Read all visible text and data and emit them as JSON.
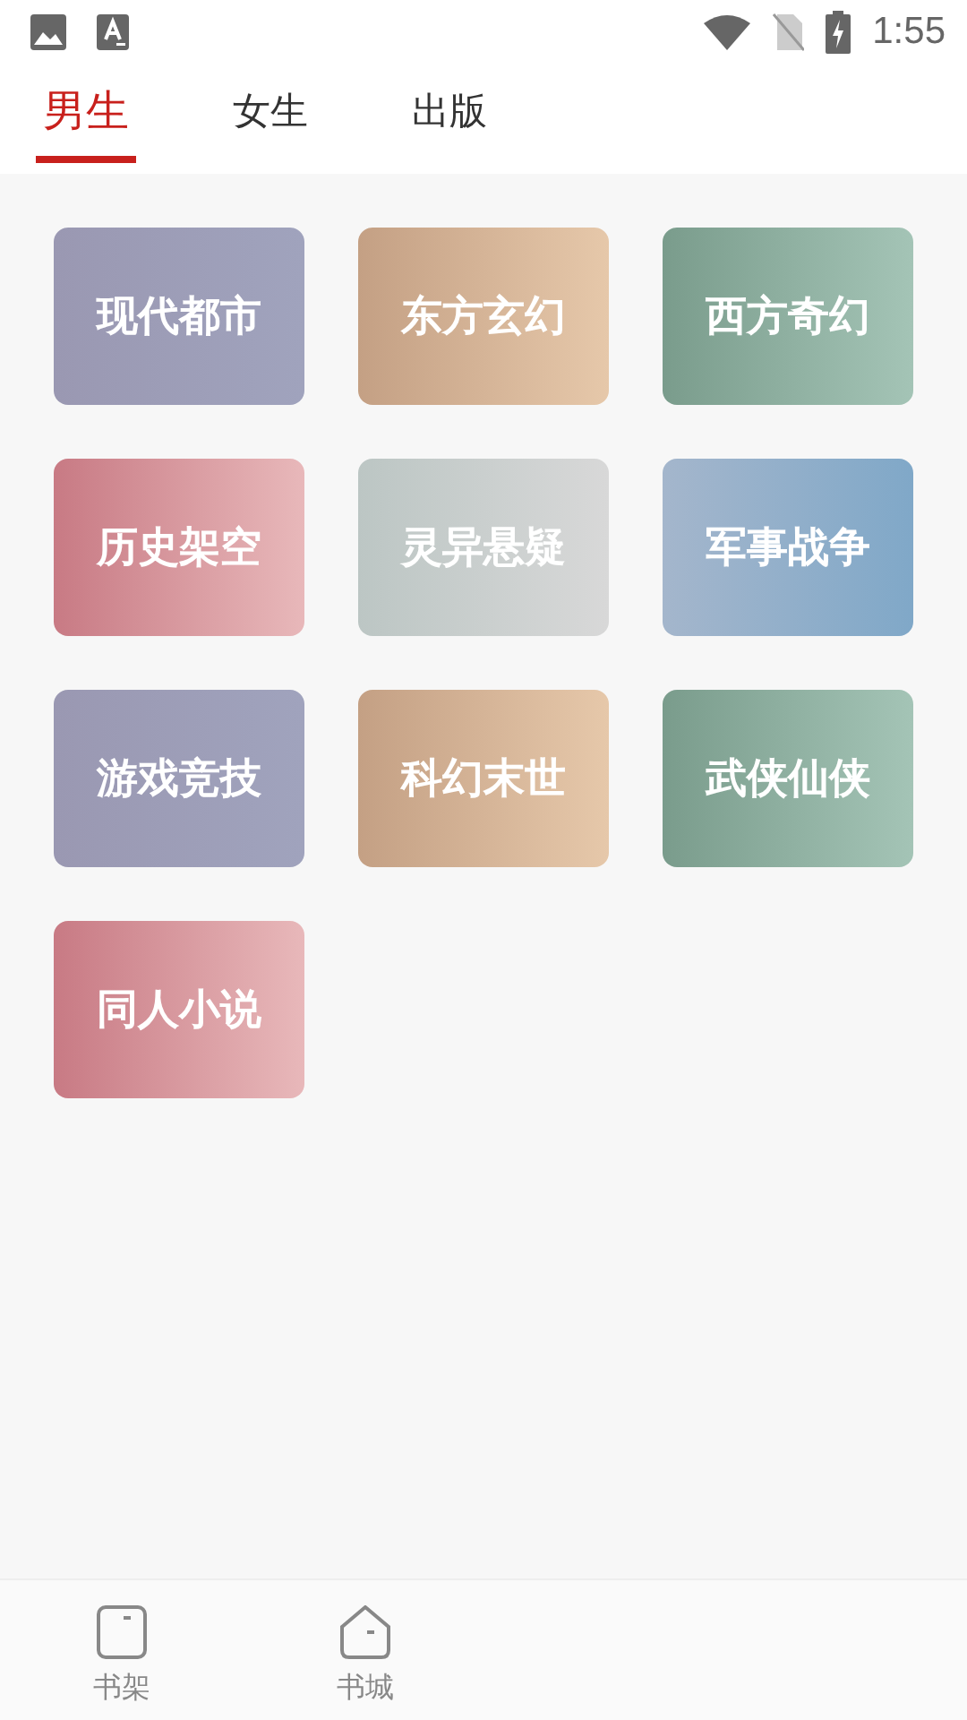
{
  "status_bar": {
    "time": "1:55"
  },
  "tabs": [
    {
      "label": "男生",
      "selected": true
    },
    {
      "label": "女生",
      "selected": false
    },
    {
      "label": "出版",
      "selected": false
    }
  ],
  "categories": [
    {
      "label": "现代都市",
      "kind": "purple"
    },
    {
      "label": "东方玄幻",
      "kind": "tan"
    },
    {
      "label": "西方奇幻",
      "kind": "green"
    },
    {
      "label": "历史架空",
      "kind": "rose"
    },
    {
      "label": "灵异悬疑",
      "kind": "silver"
    },
    {
      "label": "军事战争",
      "kind": "blue"
    },
    {
      "label": "游戏竞技",
      "kind": "purple"
    },
    {
      "label": "科幻末世",
      "kind": "tan"
    },
    {
      "label": "武侠仙侠",
      "kind": "green"
    },
    {
      "label": "同人小说",
      "kind": "rose"
    }
  ],
  "bottom_nav": [
    {
      "label": "书架",
      "kind": "shelf"
    },
    {
      "label": "书城",
      "kind": "store"
    }
  ]
}
